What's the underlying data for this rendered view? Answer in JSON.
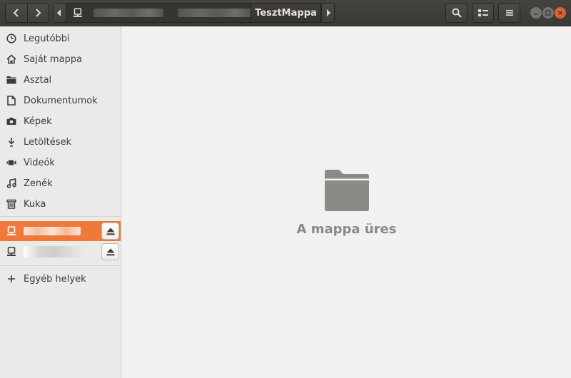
{
  "window": {
    "current_folder": "TesztMappa"
  },
  "header": {
    "back_icon": "chevron-left-icon",
    "forward_icon": "chevron-right-icon",
    "search_icon": "search-icon",
    "view_icon": "list-view-icon",
    "menu_icon": "hamburger-menu-icon"
  },
  "sidebar": {
    "places": [
      {
        "label": "Legutóbbi",
        "icon": "clock-icon"
      },
      {
        "label": "Saját mappa",
        "icon": "home-icon"
      },
      {
        "label": "Asztal",
        "icon": "desktop-folder-icon"
      },
      {
        "label": "Dokumentumok",
        "icon": "document-icon"
      },
      {
        "label": "Képek",
        "icon": "camera-icon"
      },
      {
        "label": "Letöltések",
        "icon": "download-icon"
      },
      {
        "label": "Videók",
        "icon": "video-icon"
      },
      {
        "label": "Zenék",
        "icon": "music-icon"
      },
      {
        "label": "Kuka",
        "icon": "trash-icon"
      }
    ],
    "other_places": "Egyéb helyek"
  },
  "main": {
    "empty_message": "A mappa üres"
  },
  "colors": {
    "header_bg": "#3c3b37",
    "selection": "#f0783a",
    "sidebar_bg": "#eceae8",
    "content_bg": "#f2f1f0"
  }
}
